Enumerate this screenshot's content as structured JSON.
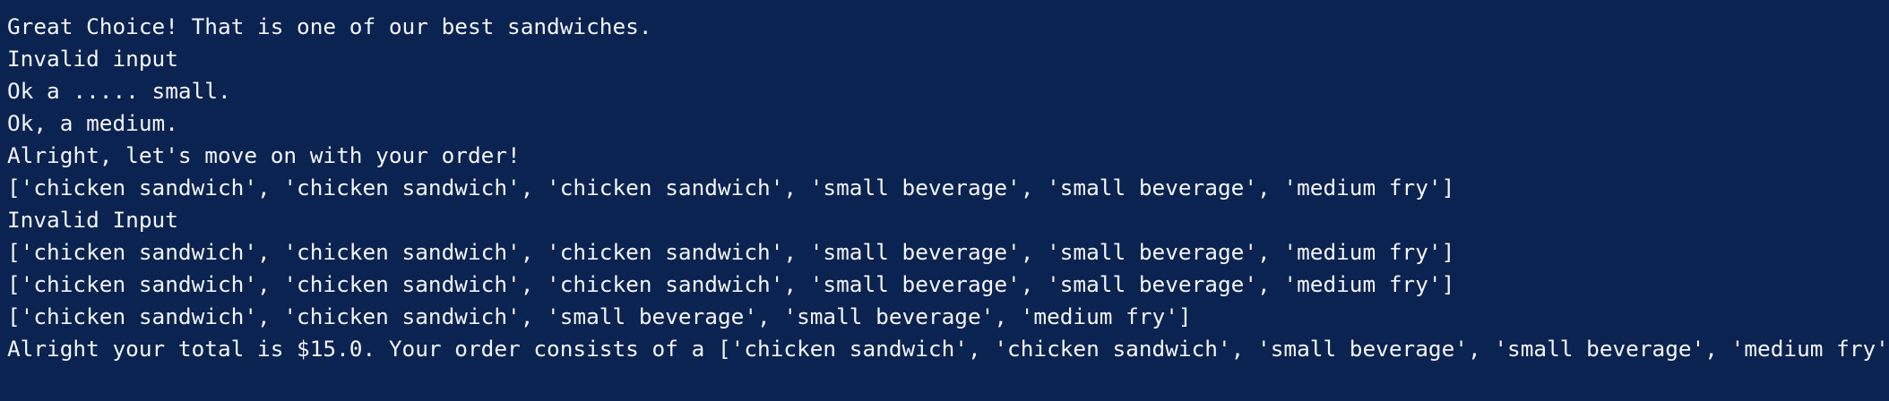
{
  "terminal": {
    "background_color": "#0b2350",
    "text_color": "#f2f5fb",
    "lines": [
      "Great Choice! That is one of our best sandwiches.",
      "Invalid input",
      "Ok a ..... small.",
      "Ok, a medium.",
      "Alright, let's move on with your order!",
      "['chicken sandwich', 'chicken sandwich', 'chicken sandwich', 'small beverage', 'small beverage', 'medium fry']",
      "Invalid Input",
      "['chicken sandwich', 'chicken sandwich', 'chicken sandwich', 'small beverage', 'small beverage', 'medium fry']",
      "['chicken sandwich', 'chicken sandwich', 'chicken sandwich', 'small beverage', 'small beverage', 'medium fry']",
      "['chicken sandwich', 'chicken sandwich', 'small beverage', 'small beverage', 'medium fry']",
      "Alright your total is $15.0. Your order consists of a ['chicken sandwich', 'chicken sandwich', 'small beverage', 'small beverage', 'medium fry']"
    ]
  }
}
